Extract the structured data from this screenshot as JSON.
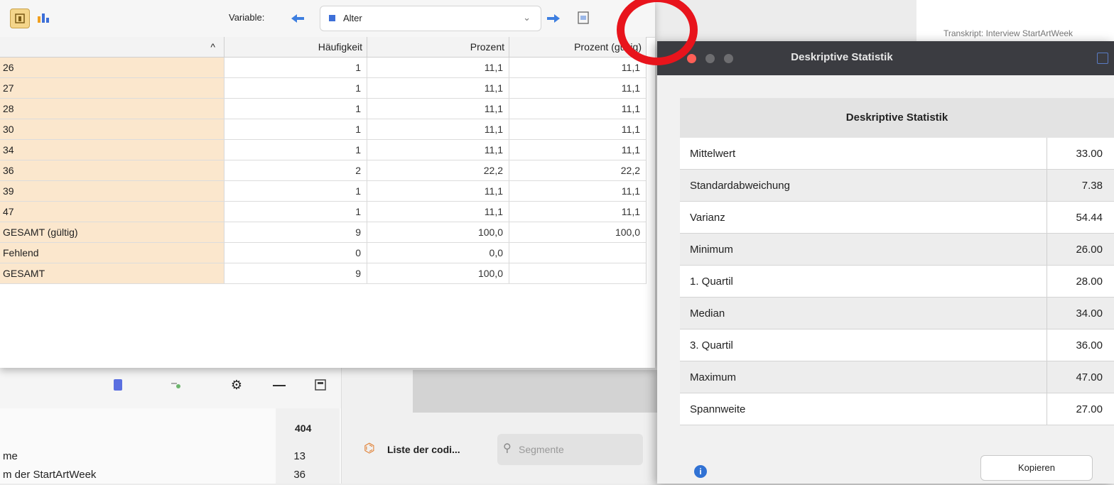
{
  "toolbar": {
    "variable_label": "Variable:",
    "variable_value": "Alter"
  },
  "freq_table": {
    "headers": [
      "^",
      "Häufigkeit",
      "Prozent",
      "Prozent (gültig)"
    ],
    "rows": [
      [
        "26",
        "1",
        "11,1",
        "11,1"
      ],
      [
        "27",
        "1",
        "11,1",
        "11,1"
      ],
      [
        "28",
        "1",
        "11,1",
        "11,1"
      ],
      [
        "30",
        "1",
        "11,1",
        "11,1"
      ],
      [
        "34",
        "1",
        "11,1",
        "11,1"
      ],
      [
        "36",
        "2",
        "22,2",
        "22,2"
      ],
      [
        "39",
        "1",
        "11,1",
        "11,1"
      ],
      [
        "47",
        "1",
        "11,1",
        "11,1"
      ],
      [
        "GESAMT (gültig)",
        "9",
        "100,0",
        "100,0"
      ],
      [
        "Fehlend",
        "0",
        "0,0",
        ""
      ],
      [
        "GESAMT",
        "9",
        "100,0",
        ""
      ]
    ]
  },
  "dialog": {
    "window_title": "Deskriptive Statistik",
    "table_title": "Deskriptive Statistik",
    "stats": [
      {
        "label": "Mittelwert",
        "value": "33.00"
      },
      {
        "label": "Standardabweichung",
        "value": "7.38"
      },
      {
        "label": "Varianz",
        "value": "54.44"
      },
      {
        "label": "Minimum",
        "value": "26.00"
      },
      {
        "label": "1. Quartil",
        "value": "28.00"
      },
      {
        "label": "Median",
        "value": "34.00"
      },
      {
        "label": "3. Quartil",
        "value": "36.00"
      },
      {
        "label": "Maximum",
        "value": "47.00"
      },
      {
        "label": "Spannweite",
        "value": "27.00"
      }
    ],
    "copy_button": "Kopieren",
    "info_glyph": "i"
  },
  "background": {
    "list_header_count": "404",
    "rows": [
      {
        "name": "me",
        "count": "13"
      },
      {
        "name": "m der StartArtWeek",
        "count": "36"
      }
    ],
    "code_list_label": "Liste der codi...",
    "search_placeholder": "Segmente",
    "edge_text": "Transkript: Interview StartArtWeek"
  },
  "colors": {
    "row_label_bg": "#fbe7cd",
    "dialog_titlebar": "#3b3c41",
    "accent_blue": "#3d6fd8",
    "annotation_red": "#e8141c"
  }
}
